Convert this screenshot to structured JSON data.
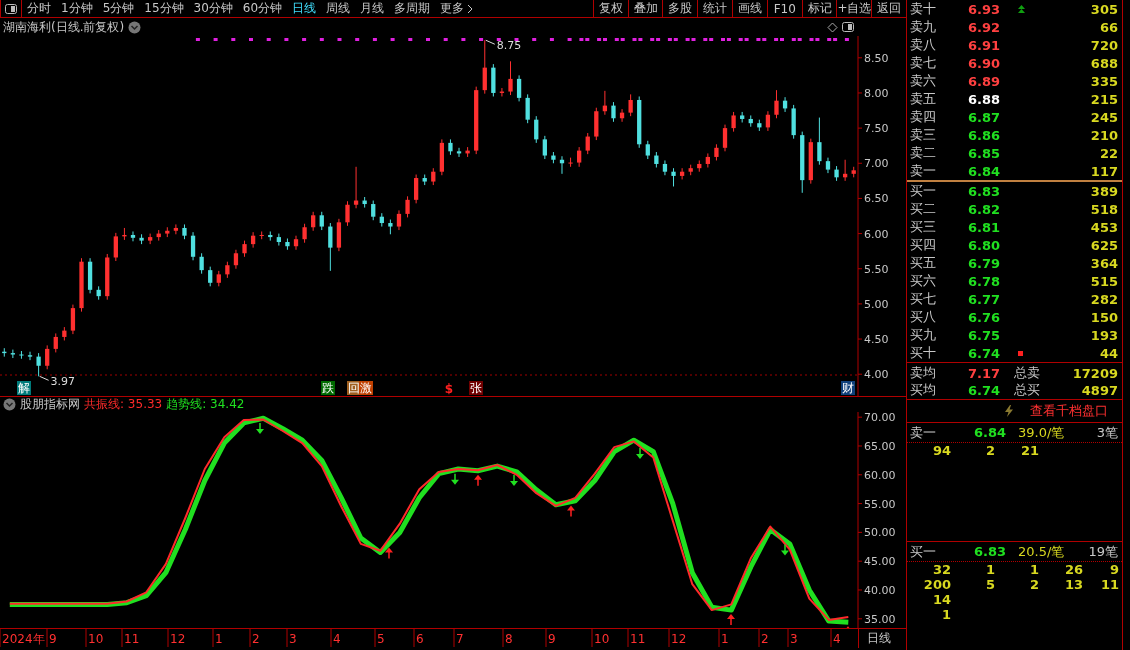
{
  "toolbar": {
    "tabs": [
      {
        "label": "分时",
        "selected": false
      },
      {
        "label": "1分钟",
        "selected": false
      },
      {
        "label": "5分钟",
        "selected": false
      },
      {
        "label": "15分钟",
        "selected": false
      },
      {
        "label": "30分钟",
        "selected": false
      },
      {
        "label": "60分钟",
        "selected": false
      },
      {
        "label": "日线",
        "selected": true
      },
      {
        "label": "周线",
        "selected": false
      },
      {
        "label": "月线",
        "selected": false
      },
      {
        "label": "多周期",
        "selected": false
      }
    ],
    "more": "更多",
    "buttons": [
      "复权",
      "叠加",
      "多股",
      "统计",
      "画线",
      "F10",
      "标记",
      "+自选",
      "返回"
    ]
  },
  "price_panel": {
    "title": "湖南海利(日线.前复权)",
    "chart_data": {
      "type": "candlestick",
      "ylim": [
        3.69,
        8.81
      ],
      "categories": [
        null,
        null,
        null,
        null,
        null,
        null,
        null,
        null,
        null,
        null,
        null,
        null,
        null,
        null,
        null,
        null,
        null,
        null,
        null,
        null,
        null,
        null,
        null,
        null,
        null,
        null,
        null,
        null,
        null,
        null,
        null,
        null,
        null,
        null,
        null,
        null,
        null,
        null,
        null,
        null,
        null,
        null,
        null,
        null,
        null,
        null,
        null,
        null,
        null,
        null,
        null,
        null,
        null,
        null,
        null,
        null,
        null,
        null,
        null,
        null,
        null,
        null,
        null,
        null,
        null,
        null,
        null,
        null,
        null,
        null,
        null,
        null,
        null,
        null,
        null,
        null,
        null,
        null,
        null,
        null,
        null,
        null,
        null,
        null,
        null,
        null,
        null,
        null,
        null,
        null,
        null,
        null,
        null,
        null,
        null,
        null,
        null,
        null,
        null,
        null
      ],
      "ohlc": [
        [
          4.32,
          4.37,
          4.25,
          4.3
        ],
        [
          4.3,
          4.35,
          4.23,
          4.28
        ],
        [
          4.28,
          4.33,
          4.22,
          4.27
        ],
        [
          4.27,
          4.32,
          4.2,
          4.25
        ],
        [
          4.25,
          4.3,
          3.97,
          4.12
        ],
        [
          4.12,
          4.41,
          4.07,
          4.36
        ],
        [
          4.36,
          4.58,
          4.31,
          4.53
        ],
        [
          4.53,
          4.67,
          4.48,
          4.62
        ],
        [
          4.62,
          4.99,
          4.57,
          4.94
        ],
        [
          4.94,
          5.65,
          4.89,
          5.6
        ],
        [
          5.6,
          5.65,
          5.15,
          5.2
        ],
        [
          5.2,
          5.25,
          5.06,
          5.11
        ],
        [
          5.11,
          5.71,
          5.06,
          5.66
        ],
        [
          5.66,
          6.01,
          5.61,
          5.96
        ],
        [
          5.96,
          6.08,
          5.91,
          5.98
        ],
        [
          5.98,
          6.03,
          5.89,
          5.94
        ],
        [
          5.94,
          5.99,
          5.85,
          5.9
        ],
        [
          5.9,
          6.0,
          5.85,
          5.95
        ],
        [
          5.95,
          6.05,
          5.9,
          6.0
        ],
        [
          6.0,
          6.09,
          5.95,
          6.04
        ],
        [
          6.04,
          6.13,
          5.99,
          6.08
        ],
        [
          6.08,
          6.13,
          5.92,
          5.97
        ],
        [
          5.97,
          6.02,
          5.62,
          5.67
        ],
        [
          5.67,
          5.72,
          5.43,
          5.48
        ],
        [
          5.48,
          5.53,
          5.25,
          5.3
        ],
        [
          5.3,
          5.47,
          5.25,
          5.42
        ],
        [
          5.42,
          5.6,
          5.37,
          5.55
        ],
        [
          5.55,
          5.77,
          5.5,
          5.72
        ],
        [
          5.72,
          5.9,
          5.67,
          5.85
        ],
        [
          5.85,
          6.02,
          5.8,
          5.97
        ],
        [
          5.97,
          6.03,
          5.92,
          5.98
        ],
        [
          5.98,
          6.03,
          5.9,
          5.95
        ],
        [
          5.95,
          6.0,
          5.83,
          5.88
        ],
        [
          5.88,
          5.93,
          5.77,
          5.82
        ],
        [
          5.82,
          5.97,
          5.77,
          5.92
        ],
        [
          5.92,
          6.14,
          5.87,
          6.09
        ],
        [
          6.09,
          6.31,
          6.04,
          6.26
        ],
        [
          6.26,
          6.31,
          6.05,
          6.1
        ],
        [
          6.1,
          6.15,
          5.47,
          5.8
        ],
        [
          5.8,
          6.21,
          5.75,
          6.16
        ],
        [
          6.16,
          6.46,
          6.11,
          6.41
        ],
        [
          6.41,
          6.95,
          6.36,
          6.47
        ],
        [
          6.47,
          6.52,
          6.37,
          6.42
        ],
        [
          6.42,
          6.47,
          6.19,
          6.24
        ],
        [
          6.24,
          6.29,
          6.1,
          6.15
        ],
        [
          6.15,
          6.2,
          5.99,
          6.1
        ],
        [
          6.1,
          6.33,
          6.05,
          6.28
        ],
        [
          6.28,
          6.53,
          6.23,
          6.48
        ],
        [
          6.48,
          6.84,
          6.43,
          6.79
        ],
        [
          6.79,
          6.84,
          6.69,
          6.74
        ],
        [
          6.74,
          6.93,
          6.69,
          6.88
        ],
        [
          6.88,
          7.34,
          6.83,
          7.29
        ],
        [
          7.29,
          7.34,
          7.12,
          7.17
        ],
        [
          7.17,
          7.22,
          7.09,
          7.14
        ],
        [
          7.14,
          7.23,
          7.09,
          7.18
        ],
        [
          7.18,
          8.09,
          7.13,
          8.04
        ],
        [
          8.04,
          8.75,
          7.99,
          8.36
        ],
        [
          8.36,
          8.41,
          7.95,
          8.0
        ],
        [
          8.0,
          8.07,
          7.95,
          8.02
        ],
        [
          8.02,
          8.45,
          7.97,
          8.2
        ],
        [
          8.2,
          8.25,
          7.88,
          7.93
        ],
        [
          7.93,
          7.98,
          7.57,
          7.62
        ],
        [
          7.62,
          7.67,
          7.29,
          7.34
        ],
        [
          7.34,
          7.39,
          7.06,
          7.11
        ],
        [
          7.11,
          7.16,
          7.0,
          7.05
        ],
        [
          7.05,
          7.1,
          6.85,
          7.0
        ],
        [
          7.0,
          7.08,
          6.95,
          7.01
        ],
        [
          7.01,
          7.23,
          6.95,
          7.18
        ],
        [
          7.18,
          7.43,
          7.13,
          7.38
        ],
        [
          7.38,
          7.79,
          7.33,
          7.74
        ],
        [
          7.74,
          8.03,
          7.69,
          7.82
        ],
        [
          7.82,
          7.87,
          7.59,
          7.64
        ],
        [
          7.64,
          7.77,
          7.59,
          7.72
        ],
        [
          7.72,
          7.98,
          7.67,
          7.9
        ],
        [
          7.9,
          7.95,
          7.22,
          7.27
        ],
        [
          7.27,
          7.32,
          7.06,
          7.11
        ],
        [
          7.11,
          7.16,
          6.94,
          6.99
        ],
        [
          6.99,
          7.04,
          6.83,
          6.88
        ],
        [
          6.88,
          6.93,
          6.67,
          6.82
        ],
        [
          6.82,
          6.93,
          6.77,
          6.88
        ],
        [
          6.88,
          6.98,
          6.83,
          6.93
        ],
        [
          6.93,
          7.04,
          6.88,
          6.99
        ],
        [
          6.99,
          7.14,
          6.94,
          7.09
        ],
        [
          7.09,
          7.27,
          7.04,
          7.22
        ],
        [
          7.22,
          7.55,
          7.17,
          7.5
        ],
        [
          7.5,
          7.73,
          7.45,
          7.68
        ],
        [
          7.68,
          7.73,
          7.58,
          7.63
        ],
        [
          7.63,
          7.68,
          7.52,
          7.57
        ],
        [
          7.57,
          7.62,
          7.46,
          7.51
        ],
        [
          7.51,
          7.74,
          7.46,
          7.69
        ],
        [
          7.69,
          8.04,
          7.64,
          7.89
        ],
        [
          7.89,
          7.94,
          7.73,
          7.78
        ],
        [
          7.78,
          7.83,
          7.35,
          7.4
        ],
        [
          7.4,
          7.45,
          6.58,
          6.76
        ],
        [
          6.76,
          7.35,
          6.71,
          7.3
        ],
        [
          7.3,
          7.65,
          6.98,
          7.03
        ],
        [
          7.03,
          7.08,
          6.86,
          6.91
        ],
        [
          6.91,
          6.96,
          6.75,
          6.8
        ],
        [
          6.8,
          7.05,
          6.75,
          6.85
        ],
        [
          6.85,
          6.95,
          6.8,
          6.9
        ]
      ],
      "yticks": [
        {
          "value": 4,
          "label": "4.00"
        },
        {
          "value": 4.5,
          "label": "4.50"
        },
        {
          "value": 5,
          "label": "5.00"
        },
        {
          "value": 5.5,
          "label": "5.50"
        },
        {
          "value": 6,
          "label": "6.00"
        },
        {
          "value": 6.5,
          "label": "6.50"
        },
        {
          "value": 7,
          "label": "7.00"
        },
        {
          "value": 7.5,
          "label": "7.50"
        },
        {
          "value": 8,
          "label": "8.00"
        },
        {
          "value": 8.5,
          "label": "8.50"
        }
      ],
      "annotations": [
        "8.75",
        "3.97"
      ]
    },
    "signal_tags": [
      {
        "kind": "tag",
        "text": "解",
        "color": "#007a7a"
      },
      {
        "kind": "tag",
        "text": "跌",
        "color": "#006a00"
      },
      {
        "kind": "tag",
        "text": "回",
        "color": "#a06020"
      },
      {
        "kind": "tag",
        "text": "激",
        "color": "#c04000"
      },
      {
        "kind": "mark",
        "text": "$",
        "color": "#ff2020"
      },
      {
        "kind": "tag",
        "text": "张",
        "color": "#700000"
      },
      {
        "kind": "tag",
        "text": "财",
        "color": "#10407a"
      }
    ]
  },
  "indicator_panel": {
    "name": "股朋指标网",
    "readings": [
      {
        "label": "共振线: 35.33",
        "color": "#ff2a2a"
      },
      {
        "label": "趋势线: 34.42",
        "color": "#20e020"
      }
    ],
    "chart_data": {
      "type": "line",
      "ylim": [
        33.4,
        70.9
      ],
      "categories": [
        null,
        null,
        null,
        null,
        null,
        null,
        null,
        null,
        null,
        null,
        null,
        null,
        null,
        null,
        null,
        null,
        null,
        null,
        null,
        null,
        null,
        null,
        null,
        null,
        null,
        null,
        null,
        null,
        null,
        null,
        null,
        null,
        null,
        null,
        null,
        null,
        null,
        null,
        null,
        null,
        null,
        null,
        null,
        null
      ],
      "series": [
        {
          "color": "#20e020",
          "values": [
            37.5,
            37.5,
            37.5,
            37.5,
            37.5,
            37.5,
            37.8,
            39,
            43,
            50.5,
            59,
            65.5,
            69,
            69.8,
            68,
            66,
            62.5,
            56,
            49,
            46.5,
            50,
            56,
            60.2,
            61,
            60.7,
            61.5,
            60.5,
            57.4,
            54.8,
            55.5,
            59,
            64,
            66,
            64,
            55,
            43,
            37,
            36.5,
            44,
            50.5,
            48,
            40,
            34.6,
            34.4
          ]
        },
        {
          "color": "#ff2a2a",
          "values": [
            37.6,
            37.6,
            37.6,
            37.6,
            37.6,
            37.6,
            38,
            39.6,
            44.5,
            52.5,
            61,
            66.5,
            69.5,
            69.6,
            67.6,
            65.5,
            61.5,
            54.5,
            48,
            46.8,
            51.5,
            57.5,
            60.5,
            61,
            60.8,
            61.7,
            60,
            56.8,
            54.6,
            56,
            60.2,
            64.8,
            65.8,
            63,
            52,
            41,
            36.5,
            37.5,
            45.5,
            51,
            47,
            38.5,
            34.8,
            35.3
          ]
        }
      ],
      "yticks": [
        {
          "value": 35,
          "label": "35.00"
        },
        {
          "value": 40,
          "label": "40.00"
        },
        {
          "value": 45,
          "label": "45.00"
        },
        {
          "value": 50,
          "label": "50.00"
        },
        {
          "value": 55,
          "label": "55.00"
        },
        {
          "value": 60,
          "label": "60.00"
        },
        {
          "value": 65,
          "label": "65.00"
        },
        {
          "value": 70,
          "label": "70.00"
        }
      ]
    }
  },
  "time_axis": {
    "labels": [
      "2024年",
      "9",
      "10",
      "11",
      "12",
      "1",
      "2",
      "3",
      "4",
      "5",
      "6",
      "7",
      "8",
      "9",
      "10",
      "11",
      "12",
      "1",
      "2",
      "3",
      "4"
    ],
    "period": "日线"
  },
  "order_book": {
    "asks": [
      {
        "kind": "up_flag",
        "label": "卖十",
        "price": "6.93",
        "volume": "305",
        "color": "#ff4040"
      },
      {
        "kind": "plain",
        "label": "卖九",
        "price": "6.92",
        "volume": "66",
        "color": "#ff4040"
      },
      {
        "kind": "plain",
        "label": "卖八",
        "price": "6.91",
        "volume": "720",
        "color": "#ff4040"
      },
      {
        "kind": "plain",
        "label": "卖七",
        "price": "6.90",
        "volume": "688",
        "color": "#ff4040"
      },
      {
        "kind": "plain",
        "label": "卖六",
        "price": "6.89",
        "volume": "335",
        "color": "#ff4040"
      },
      {
        "kind": "plain",
        "label": "卖五",
        "price": "6.88",
        "volume": "215",
        "color": "#ffffff"
      },
      {
        "kind": "plain",
        "label": "卖四",
        "price": "6.87",
        "volume": "245",
        "color": "#20e020"
      },
      {
        "kind": "plain",
        "label": "卖三",
        "price": "6.86",
        "volume": "210",
        "color": "#20e020"
      },
      {
        "kind": "plain",
        "label": "卖二",
        "price": "6.85",
        "volume": "22",
        "color": "#20e020"
      },
      {
        "kind": "plain",
        "label": "卖一",
        "price": "6.84",
        "volume": "117",
        "color": "#20e020"
      }
    ],
    "bids": [
      {
        "kind": "plain",
        "label": "买一",
        "price": "6.83",
        "volume": "389",
        "color": "#20e020"
      },
      {
        "kind": "plain",
        "label": "买二",
        "price": "6.82",
        "volume": "518",
        "color": "#20e020"
      },
      {
        "kind": "plain",
        "label": "买三",
        "price": "6.81",
        "volume": "453",
        "color": "#20e020"
      },
      {
        "kind": "plain",
        "label": "买四",
        "price": "6.80",
        "volume": "625",
        "color": "#20e020"
      },
      {
        "kind": "plain",
        "label": "买五",
        "price": "6.79",
        "volume": "364",
        "color": "#20e020"
      },
      {
        "kind": "plain",
        "label": "买六",
        "price": "6.78",
        "volume": "515",
        "color": "#20e020"
      },
      {
        "kind": "plain",
        "label": "买七",
        "price": "6.77",
        "volume": "282",
        "color": "#20e020"
      },
      {
        "kind": "plain",
        "label": "买八",
        "price": "6.76",
        "volume": "150",
        "color": "#20e020"
      },
      {
        "kind": "plain",
        "label": "买九",
        "price": "6.75",
        "volume": "193",
        "color": "#20e020"
      },
      {
        "kind": "dot_flag",
        "label": "买十",
        "price": "6.74",
        "volume": "44",
        "color": "#20e020"
      }
    ],
    "summary": [
      {
        "label": "卖均",
        "price": "7.17",
        "color": "#ff4040",
        "total_label": "总卖",
        "total": "17209"
      },
      {
        "label": "买均",
        "price": "6.74",
        "color": "#20e020",
        "total_label": "总买",
        "total": "4897"
      }
    ],
    "link": "查看千档盘口",
    "queues": [
      {
        "label": "卖一",
        "price": "6.84",
        "average": "39.0/笔",
        "count": "3笔",
        "rows": [
          [
            "94",
            "2",
            "21"
          ]
        ]
      },
      {
        "label": "买一",
        "price": "6.83",
        "average": "20.5/笔",
        "count": "19笔",
        "rows": [
          [
            "32",
            "1",
            "1",
            "26",
            "9"
          ],
          [
            "200",
            "5",
            "2",
            "13",
            "11"
          ],
          [
            "14"
          ],
          [
            "1"
          ]
        ]
      }
    ]
  }
}
